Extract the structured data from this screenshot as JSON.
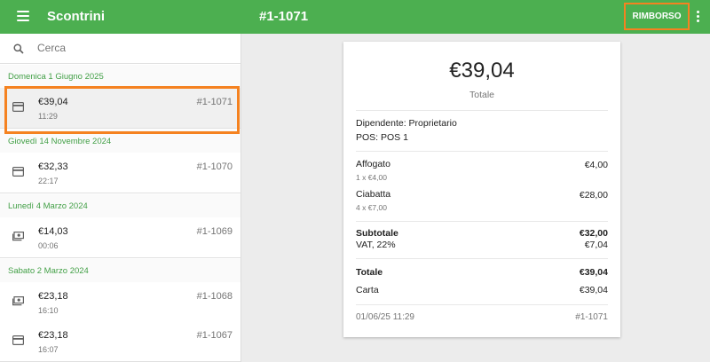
{
  "appbar": {
    "title": "Scontrini",
    "receipt_number": "#1-1071",
    "refund_label": "RIMBORSO"
  },
  "search": {
    "placeholder": "Cerca"
  },
  "groups": [
    {
      "date": "Domenica 1 Giugno 2025"
    },
    {
      "date": "Giovedì 14 Novembre 2024"
    },
    {
      "date": "Lunedì 4 Marzo 2024"
    },
    {
      "date": "Sabato 2 Marzo 2024"
    }
  ],
  "receipts": [
    {
      "amount": "€39,04",
      "time": "11:29",
      "number": "#1-1071",
      "icon": "card-icon",
      "selected": true
    },
    {
      "amount": "€32,33",
      "time": "22:17",
      "number": "#1-1070",
      "icon": "card-icon"
    },
    {
      "amount": "€14,03",
      "time": "00:06",
      "number": "#1-1069",
      "icon": "cash-icon"
    },
    {
      "amount": "€23,18",
      "time": "16:10",
      "number": "#1-1068",
      "icon": "cash-icon"
    },
    {
      "amount": "€23,18",
      "time": "16:07",
      "number": "#1-1067",
      "icon": "card-icon"
    }
  ],
  "detail": {
    "total": "€39,04",
    "total_caption": "Totale",
    "employee": "Dipendente: Proprietario",
    "pos": "POS: POS 1",
    "lines": [
      {
        "name": "Affogato",
        "qty": "1 x €4,00",
        "price": "€4,00"
      },
      {
        "name": "Ciabatta",
        "qty": "4 x €7,00",
        "price": "€28,00"
      }
    ],
    "subtotal_label": "Subtotale",
    "subtotal": "€32,00",
    "vat_label": "VAT, 22%",
    "vat": "€7,04",
    "total_label": "Totale",
    "total_value": "€39,04",
    "payment_label": "Carta",
    "payment_value": "€39,04",
    "footer_date": "01/06/25 11:29",
    "footer_number": "#1-1071"
  },
  "colors": {
    "primary": "#4caf50",
    "accent_group": "#43a047",
    "highlight": "#f58220"
  }
}
